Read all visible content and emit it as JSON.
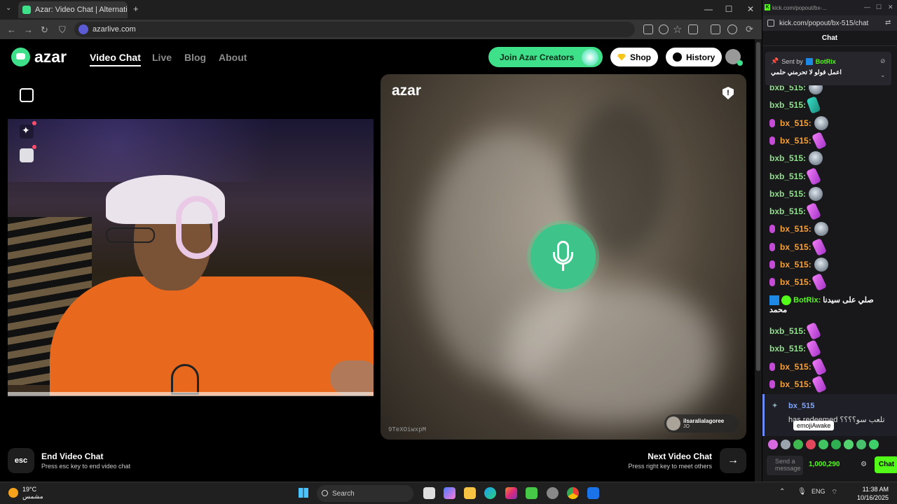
{
  "browser": {
    "tab_title": "Azar: Video Chat | Alternati",
    "url": "azarlive.com"
  },
  "site": {
    "logo_text": "azar",
    "nav": [
      "Video Chat",
      "Live",
      "Blog",
      "About"
    ],
    "join_creators": "Join Azar Creators",
    "shop": "Shop",
    "history": "History"
  },
  "stage": {
    "remote_logo": "azar",
    "report_symbol": "!",
    "peer_id": "9TeXOiwxpM",
    "partner_name": "ilsaralialagoree",
    "partner_country": "JO"
  },
  "footer": {
    "esc_key": "esc",
    "end_title": "End Video Chat",
    "end_sub": "Press esc key to end video chat",
    "next_title": "Next Video Chat",
    "next_sub": "Press right key to meet others",
    "next_arrow": "→"
  },
  "chat_window": {
    "url": "kick.com/popout/bx-...",
    "address": "kick.com/popout/bx-515/chat",
    "header": "Chat",
    "pinned": {
      "sent_by": "Sent by",
      "bot": "BotRix",
      "message": "اعمل فولو لا تحرمني حلمي"
    },
    "messages": [
      {
        "user": "bxb_515:",
        "color": "#8fe08a",
        "mic": false,
        "emote": "rat"
      },
      {
        "user": "bxb_515:",
        "color": "#8fe08a",
        "mic": false,
        "emote": "teal"
      },
      {
        "user": "bx_515:",
        "color": "#f5a03a",
        "mic": true,
        "emote": "rat"
      },
      {
        "user": "bx_515:",
        "color": "#f5a03a",
        "mic": true,
        "emote": "spiral"
      },
      {
        "user": "bxb_515:",
        "color": "#8fe08a",
        "mic": false,
        "emote": "rat"
      },
      {
        "user": "bxb_515:",
        "color": "#8fe08a",
        "mic": false,
        "emote": "spiral"
      },
      {
        "user": "bxb_515:",
        "color": "#8fe08a",
        "mic": false,
        "emote": "rat"
      },
      {
        "user": "bxb_515:",
        "color": "#8fe08a",
        "mic": false,
        "emote": "spiral"
      },
      {
        "user": "bx_515:",
        "color": "#f5a03a",
        "mic": true,
        "emote": "rat"
      },
      {
        "user": "bx_515:",
        "color": "#f5a03a",
        "mic": true,
        "emote": "spiral"
      },
      {
        "user": "bx_515:",
        "color": "#f5a03a",
        "mic": true,
        "emote": "rat"
      },
      {
        "user": "bx_515:",
        "color": "#f5a03a",
        "mic": true,
        "emote": "spiral"
      }
    ],
    "bot_message": {
      "user": "BotRix:",
      "text": "صلي على سيدنا محمد"
    },
    "messages2": [
      {
        "user": "bxb_515:",
        "color": "#8fe08a",
        "mic": false,
        "emote": "spiral"
      },
      {
        "user": "bxb_515:",
        "color": "#8fe08a",
        "mic": false,
        "emote": "spiral"
      },
      {
        "user": "bx_515:",
        "color": "#f5a03a",
        "mic": true,
        "emote": "spiral"
      },
      {
        "user": "bx_515:",
        "color": "#f5a03a",
        "mic": true,
        "emote": "spiral"
      }
    ],
    "redeem": {
      "user": "bx_515",
      "text": "has redeemed تلعب سو؟؟؟؟"
    },
    "tooltip": "emojiAwake",
    "send_placeholder": "Send a message",
    "points": "1,000,290",
    "chat_button": "Chat"
  },
  "taskbar": {
    "temp": "19°C",
    "condition": "مشمس",
    "search": "Search",
    "lang": "ENG",
    "time": "11:38 AM",
    "date": "10/16/2025"
  }
}
